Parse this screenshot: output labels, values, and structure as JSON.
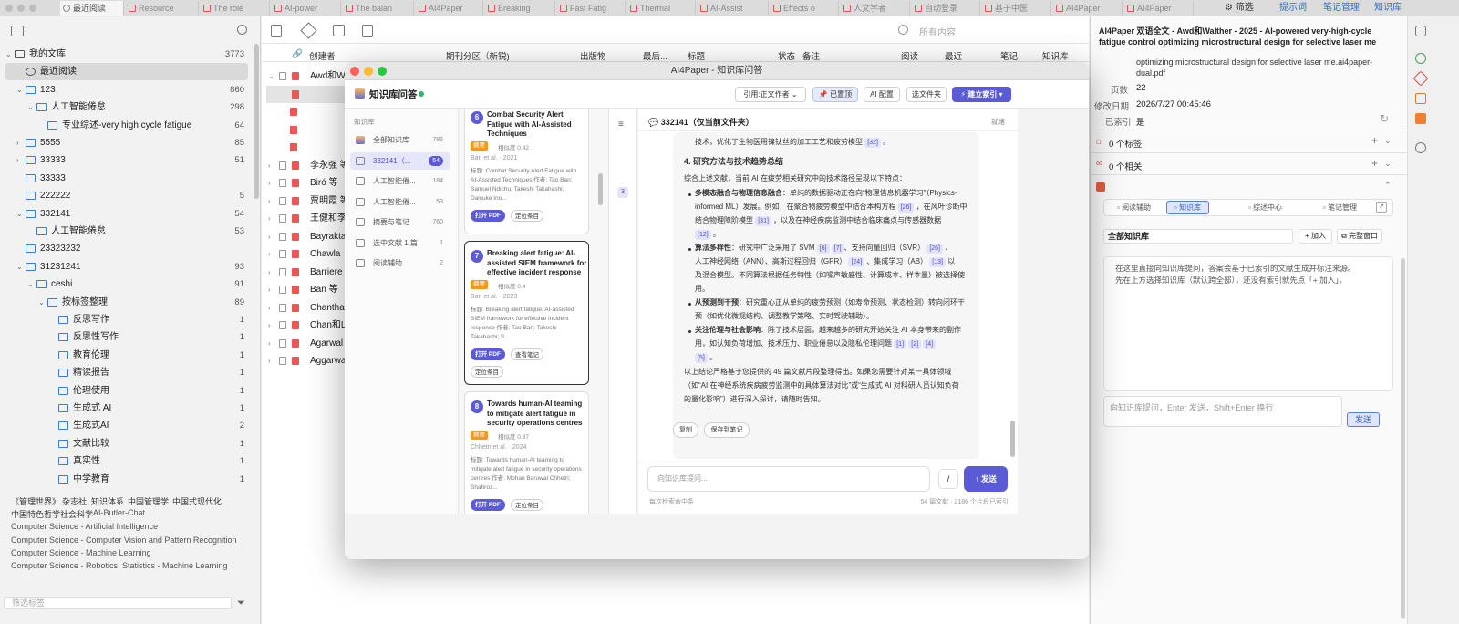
{
  "tabbar": {
    "tabs": [
      {
        "label": "最近阅读",
        "active": true
      },
      {
        "label": "Resource"
      },
      {
        "label": "The role"
      },
      {
        "label": "AI-power"
      },
      {
        "label": "The balan"
      },
      {
        "label": "AI4Paper"
      },
      {
        "label": "Breaking"
      },
      {
        "label": "Fast Fatig"
      },
      {
        "label": "Thermal"
      },
      {
        "label": "AI-Assist"
      },
      {
        "label": "Effects o"
      },
      {
        "label": "人文学者"
      },
      {
        "label": "自动登录"
      },
      {
        "label": "基于中医"
      },
      {
        "label": "AI4Paper"
      },
      {
        "label": "AI4Paper"
      }
    ],
    "filter_label": "筛选",
    "prompt_label": "提示词",
    "notes_label": "笔记管理",
    "kb_label": "知识库"
  },
  "library": {
    "items": [
      {
        "label": "我的文库",
        "count": "3773"
      },
      {
        "label": "最近阅读",
        "count": ""
      },
      {
        "label": "123",
        "count": "860"
      },
      {
        "label": "人工智能倦怠",
        "count": "298"
      },
      {
        "label": "专业综述-very high cycle fatigue",
        "count": "64"
      },
      {
        "label": "5555",
        "count": "85"
      },
      {
        "label": "33333",
        "count": "51"
      },
      {
        "label": "33333",
        "count": ""
      },
      {
        "label": "222222",
        "count": "5"
      },
      {
        "label": "332141",
        "count": "54"
      },
      {
        "label": "人工智能倦怠",
        "count": "53"
      },
      {
        "label": "23323232",
        "count": ""
      },
      {
        "label": "31231241",
        "count": "93"
      },
      {
        "label": "ceshi",
        "count": "91"
      },
      {
        "label": "按标签整理",
        "count": "89"
      },
      {
        "label": "反思写作",
        "count": "1"
      },
      {
        "label": "反思性写作",
        "count": "1"
      },
      {
        "label": "教育伦理",
        "count": "1"
      },
      {
        "label": "精读报告",
        "count": "1"
      },
      {
        "label": "伦理使用",
        "count": "1"
      },
      {
        "label": "生成式 AI",
        "count": "1"
      },
      {
        "label": "生成式AI",
        "count": "2"
      },
      {
        "label": "文献比较",
        "count": "1"
      },
      {
        "label": "真实性",
        "count": "1"
      },
      {
        "label": "中学教育",
        "count": "1"
      }
    ],
    "tags_row1": [
      "《管理世界》",
      "杂志社",
      "知识体系",
      "中国管理学",
      "中国式现代化"
    ],
    "tags_row2": [
      "中国特色哲学社会科学",
      "AI-Butler-Chat"
    ],
    "tags_lines": [
      "Computer Science - Artificial Intelligence",
      "Computer Science - Computer Vision and Pattern Recognition",
      "Computer Science - Machine Learning"
    ],
    "tags_last": [
      "Computer Science - Robotics",
      "Statistics - Machine Learning"
    ],
    "tag_filter_placeholder": "筛选标签"
  },
  "items_list": {
    "search_placeholder": "所有内容",
    "columns": [
      "创建者",
      "期刊分区（新锐)",
      "出版物",
      "最后...",
      "标题",
      "状态",
      "备注",
      "阅读",
      "最近",
      "笔记",
      "知识库"
    ],
    "creators": [
      "Awd和Wa",
      "",
      "",
      "",
      "",
      "李永强 等",
      "Biró 等",
      "贾明霞 等",
      "王健和李",
      "Bayrakta",
      "Chawla",
      "Barriere",
      "Ban 等",
      "Chanthav",
      "Chan和Le",
      "Agarwal",
      "Aggarwal"
    ]
  },
  "dialog": {
    "window_title": "AI4Paper - 知识库问答",
    "app_title": "知识库问答",
    "cite_style": "引用:正文作者",
    "indexed_btn": "已置顶",
    "ai_config_btn": "AI 配置",
    "choose_folder_btn": "选文件夹",
    "build_index_btn": "建立索引",
    "kb_section_label": "知识库",
    "kb_items": [
      {
        "label": "全部知识库",
        "count": "786"
      },
      {
        "label": "332141（...",
        "count": "54"
      },
      {
        "label": "人工智能倦...",
        "count": "184"
      },
      {
        "label": "人工智能倦...",
        "count": "53"
      },
      {
        "label": "摘要与笔记...",
        "count": "760"
      },
      {
        "label": "选中文献 1 篇",
        "count": "1"
      },
      {
        "label": "阅读辅助",
        "count": "2"
      }
    ],
    "cards": [
      {
        "num": "6",
        "title": "Combat Security Alert Fatigue with AI-Assisted Techniques",
        "badge": "摘要",
        "relevance": "相似度 0.42",
        "meta": "Ban et al. · 2021",
        "abstract": "标题: Combat Security Alert Fatigue with AI-Assisted Techniques 作者: Tao Ban; Samuel Ndichu; Takeshi Takahashi; Daisuke Ino...",
        "open_pdf": "打开 PDF",
        "locate": "定位条目"
      },
      {
        "num": "7",
        "title": "Breaking alert fatigue: AI-assisted SIEM framework for effective incident response",
        "badge": "摘要",
        "relevance": "相似度 0.4",
        "meta": "Ban et al. · 2023",
        "abstract": "标题: Breaking alert fatigue: AI-assisted SIEM framework for effective incident response 作者: Tao Ban; Takeshi Takahashi; S...",
        "open_pdf": "打开 PDF",
        "view_notes": "查看笔记",
        "locate": "定位条目"
      },
      {
        "num": "8",
        "title": "Towards human-AI teaming to mitigate alert fatigue in security operations centres",
        "badge": "摘要",
        "relevance": "相似度 0.37",
        "meta": "Chhetri et al. · 2024",
        "abstract": "标题: Towards human-AI teaming to mitigate alert fatigue in security operations centres 作者: Mohan Baruwal Chhetri; Shahroz...",
        "open_pdf": "打开 PDF",
        "locate": "定位条目"
      }
    ],
    "chat_header": "332141（仅当前文件夹）",
    "chat_status": "就绪",
    "answer": {
      "line0": "技术，优化了生物医用镍钛丝的加工工艺和疲劳模型",
      "line0_cite": "[32]",
      "heading": "4. 研究方法与技术趋势总结",
      "intro": "综合上述文献，当前 AI 在疲劳相关研究中的技术路径呈现以下特点：",
      "b1_bold": "多模态融合与物理信息融合",
      "b1_l1": "：单纯的数据驱动正在向“物理信息机器学习”（Physics-",
      "b1_l2": "informed ML）发展。例如，在聚合物疲劳模型中结合本构方程",
      "b1_c1": "[26]",
      "b1_l2b": "，在风叶诊断中",
      "b1_l3": "结合物理障阶模型",
      "b1_c2": "[31]",
      "b1_l3b": "，以及在神经疾病监测中结合临床痛点与传感器数据",
      "b1_c3": "[12]",
      "b2_bold": "算法多样性",
      "b2_l1": "：研究中广泛采用了 SVM",
      "b2_c1": "[6]",
      "b2_c2": "[7]",
      "b2_l1b": "、支持向量回归（SVR）",
      "b2_c3": "[26]",
      "b2_l2": "人工神经网络（ANN）、高斯过程回归（GPR）",
      "b2_c4": "[24]",
      "b2_l2b": "、集成学习（AB）",
      "b2_c5": "[13]",
      "b2_l2c": "以",
      "b2_l3": "及混合模型。不同算法根据任务特性（如噪声敏感性、计算成本、样本量）被选择使",
      "b2_l4": "用。",
      "b3_bold": "从预测到干预",
      "b3_l1": "：研究重心正从单纯的疲劳预测（如寿命预测、状态检测）转向闭环干",
      "b3_l2": "预（如优化微观结构、调整教学策略、实时驾驶辅助）。",
      "b4_bold": "关注伦理与社会影响",
      "b4_l1": "：除了技术层面，越来越多的研究开始关注 AI 本身带来的副作",
      "b4_l2": "用，如认知负荷增加、技术压力、职业倦怠以及隐私伦理问题",
      "b4_c1": "[1]",
      "b4_c2": "[2]",
      "b4_c3": "[4]",
      "b4_c4": "[5]",
      "outro1": "以上结论严格基于您提供的 49 篇文献片段整理得出。如果您需要针对某一具体领域",
      "outro2": "（如“AI 在神经系统疾病疲劳监测中的具体算法对比”或“生成式 AI 对科研人员认知负荷",
      "outro3": "的量化影响”）进行深入探讨，请随时告知。"
    },
    "copy_btn": "复制",
    "save_note_btn": "保存到笔记",
    "input_placeholder": "向知识库提问...",
    "slash_btn": "/",
    "send_btn": "发送",
    "footer_left": "每次检索命中条",
    "footer_right": "54 篇文献 · 2186 个片段已索引",
    "side_num": "3"
  },
  "right_pane": {
    "title": "AI4Paper 双语全文 - Awd和Walther - 2025 - AI-powered very-high-cycle fatigue control optimizing microstructural design for selective laser me",
    "filename": "optimizing microstructural design for selective laser me.ai4paper-dual.pdf",
    "pages_label": "页数",
    "pages_value": "22",
    "modified_label": "修改日期",
    "modified_value": "2026/7/27 00:45:46",
    "indexed_label": "已索引",
    "indexed_value": "是",
    "tags_count": "0 个标签",
    "related_count": "0 个相关",
    "subtabs": [
      "阅读辅助",
      "知识库",
      "综述中心",
      "笔记管理"
    ],
    "kb_select": "全部知识库",
    "add_btn": "+ 加入",
    "full_window_btn": "完整窗口",
    "info_text1": "在这里直接向知识库提问，答案会基于已索引的文献生成并标注来源。",
    "info_text2": "先在上方选择知识库（默认跨全部），还没有索引就先点「+ 加入」。",
    "ask_placeholder": "向知识库提问，Enter 发送，Shift+Enter 换行",
    "send_btn": "发送"
  }
}
